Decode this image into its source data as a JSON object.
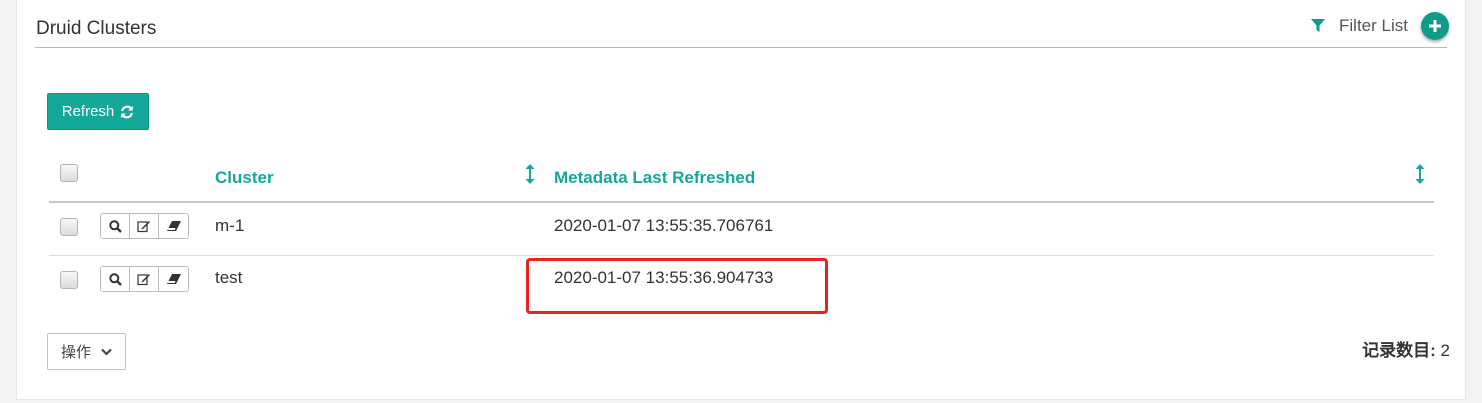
{
  "header": {
    "title": "Druid Clusters",
    "filter_label": "Filter List",
    "filter_icon": "filter-icon",
    "add_icon": "plus-icon"
  },
  "toolbar": {
    "refresh_label": "Refresh",
    "refresh_icon": "refresh-icon"
  },
  "table": {
    "columns": [
      "Cluster",
      "Metadata Last Refreshed"
    ],
    "rows": [
      {
        "cluster": "m-1",
        "refreshed": "2020-01-07 13:55:35.706761",
        "actions": [
          "search-icon",
          "edit-icon",
          "eraser-icon"
        ]
      },
      {
        "cluster": "test",
        "refreshed": "2020-01-07 13:55:36.904733",
        "actions": [
          "search-icon",
          "edit-icon",
          "eraser-icon"
        ]
      }
    ]
  },
  "footer": {
    "actions_label": "操作",
    "record_label": "记录数目:",
    "record_count": "2"
  },
  "colors": {
    "accent": "#14a89a",
    "highlight": "#e8241e"
  }
}
